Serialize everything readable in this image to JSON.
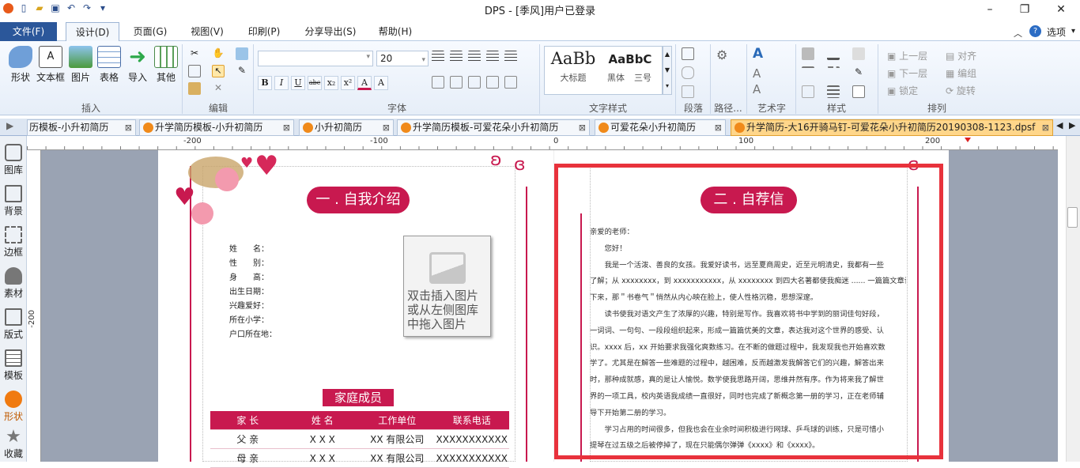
{
  "app": {
    "title": "DPS - [季风]用户已登录"
  },
  "menu": {
    "file": "文件(F)",
    "tabs": [
      "设计(D)",
      "页面(G)",
      "视图(V)",
      "印刷(P)",
      "分享导出(S)",
      "帮助(H)"
    ],
    "options": "选项"
  },
  "ribbon": {
    "insert": {
      "buttons": [
        "形状",
        "文本框",
        "图片",
        "表格",
        "导入",
        "其他"
      ],
      "label": "插入"
    },
    "edit": {
      "label": "编辑"
    },
    "font": {
      "size": "20",
      "label": "字体",
      "buttons": [
        "B",
        "I",
        "U",
        "abc",
        "x₂",
        "x²",
        "A",
        "A"
      ]
    },
    "textstyle": {
      "label": "文字样式",
      "big": "AaBb",
      "big_caption": "大标题",
      "med": "AaBbC",
      "med_caption1": "黑体",
      "med_caption2": "三号"
    },
    "paragraph": {
      "label": "段落"
    },
    "path": {
      "label": "路径..."
    },
    "art": {
      "label": "艺术字"
    },
    "style": {
      "label": "样式"
    },
    "arrange": {
      "label": "排列",
      "up": "上一层",
      "down": "下一层",
      "lock": "锁定",
      "align": "对齐",
      "group": "编组",
      "rotate": "旋转"
    }
  },
  "doc_tabs": [
    "历模板-小升初简历",
    "升学简历模板-小升初简历",
    "小升初简历",
    "升学简历模板-可爱花朵小升初简历",
    "可爱花朵小升初简历",
    "升学简历-大16开骑马钉-可爱花朵小升初简历20190308-1123.dpsf"
  ],
  "sidebar": [
    "图库",
    "背景",
    "边框",
    "素材",
    "版式",
    "模板",
    "形状",
    "收藏"
  ],
  "ruler": {
    "h": [
      "-200",
      "-100",
      "0",
      "100",
      "200"
    ],
    "v": [
      "-200"
    ]
  },
  "page_left": {
    "section_title": "一 . 自我介绍",
    "fields": [
      "姓　　名：",
      "性　　别：",
      "身　　高：",
      "出生日期：",
      "兴趣爱好：",
      "所在小学：",
      "户口所在地："
    ],
    "photo_placeholder": [
      "双击插入图片",
      "或从左侧图库",
      "中拖入图片"
    ],
    "family_title": "家庭成员",
    "table_header": [
      "家 长",
      "姓 名",
      "工作单位",
      "联系电话"
    ],
    "table_rows": [
      [
        "父 亲",
        "X X X",
        "XX 有限公司",
        "XXXXXXXXXXX"
      ],
      [
        "母 亲",
        "X X X",
        "XX 有限公司",
        "XXXXXXXXXXX"
      ]
    ]
  },
  "page_right": {
    "section_title": "二 . 自荐信",
    "lines": [
      "亲爱的老师：",
      "　　您好！",
      "　　我是一个活泼、善良的女孩。我爱好读书，远至夏商周史，近至元明清史，我都有一些",
      "了解；从 xxxxxxxx，到 xxxxxxxxxxx，从 xxxxxxxx 到四大名著都使我痴迷 ...... 一篇篇文章读",
      "下来，那＂书卷气＂悄然从内心映在脸上，使人性格沉稳，思想深邃。",
      "　　读书使我对语文产生了浓厚的兴趣，特别是写作。我喜欢将书中学到的丽词佳句好段，",
      "一词词、一句句、一段段组织起来，形成一篇篇优美的文章，表达我对这个世界的感受、认",
      "识。xxxx 后，xx 开始要求我强化爽数练习。在不断的做题过程中，我发现我也开始喜欢数",
      "学了。尤其是在解答一些难题的过程中，越困难，反而越激发我解答它们的兴趣，解答出来",
      "时，那种成就感，真的是让人愉悦。数学使我思路开阔，思维井然有序。作为将来我了解世",
      "界的一项工具，校内英语我成绩一直很好，同时也完成了新概念第一册的学习，正在老师辅",
      "导下开始第二册的学习。",
      "　　学习占用的时间很多，但我也会在业余时间积极进行网球、乒乓球的训练，只是可惜小",
      "提琴在过五级之后被停掉了，现在只能偶尔弹弹《xxxx》和《xxxx》。"
    ]
  },
  "colors": {
    "accent": "#c8194f",
    "selection": "#e8323c"
  }
}
